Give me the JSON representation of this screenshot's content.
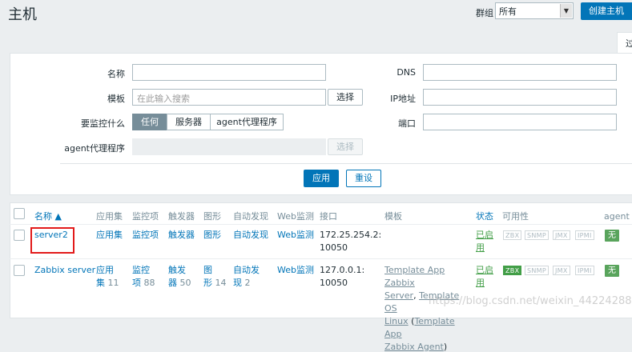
{
  "header": {
    "title": "主机",
    "group_label": "群组",
    "group_value": "所有",
    "create_button": "创建主机",
    "filter_tab": "过"
  },
  "filter": {
    "name_label": "名称",
    "name_value": "",
    "template_label": "模板",
    "template_placeholder": "在此输入搜索",
    "template_select": "选择",
    "monitor_label": "要监控什么",
    "monitor_options": [
      "任何",
      "服务器",
      "agent代理程序"
    ],
    "monitor_selected": "任何",
    "proxy_label": "agent代理程序",
    "proxy_select": "选择",
    "dns_label": "DNS",
    "ip_label": "IP地址",
    "port_label": "端口",
    "apply_button": "应用",
    "reset_button": "重设"
  },
  "table": {
    "headers": {
      "name": "名称 ▲",
      "applications": "应用集",
      "items": "监控项",
      "triggers": "触发器",
      "graphs": "图形",
      "discovery": "自动发现",
      "web": "Web监测",
      "interface": "接口",
      "templates": "模板",
      "status": "状态",
      "availability": "可用性",
      "agent": "agent 加"
    },
    "rows": [
      {
        "name": "server2",
        "applications": "应用集",
        "items": "监控项",
        "triggers": "触发器",
        "graphs": "图形",
        "discovery": "自动发现",
        "web": "Web监测",
        "interface_line1": "172.25.254.2:",
        "interface_line2": "10050",
        "templates": "",
        "status_line1": "已启",
        "status_line2": "用",
        "availability": [
          "ZBX",
          "SNMP",
          "JMX",
          "IPMI"
        ],
        "zbx_active": false,
        "agent_encryption": "无"
      },
      {
        "name": "Zabbix server",
        "applications_l1": "应用",
        "applications_l2": "集",
        "applications_count": "11",
        "items_l1": "监控",
        "items_l2": "项",
        "items_count": "88",
        "triggers_l1": "触发",
        "triggers_l2": "器",
        "triggers_count": "50",
        "graphs_l1": "图",
        "graphs_l2": "形",
        "graphs_count": "14",
        "discovery_l1": "自动发",
        "discovery_l2": "现",
        "discovery_count": "2",
        "web": "Web监测",
        "interface_line1": "127.0.0.1:",
        "interface_line2": "10050",
        "template_1a": "Template App Zabbix",
        "template_1b": "Server",
        "template_sep": ",",
        "template_2a": "Template OS",
        "template_2b": "Linux",
        "template_paren_open": "(",
        "template_3a": "Template App",
        "template_3b": "Zabbix Agent",
        "template_paren_close": ")",
        "status_line1": "已启",
        "status_line2": "用",
        "availability": [
          "ZBX",
          "SNMP",
          "JMX",
          "IPMI"
        ],
        "zbx_active": true,
        "agent_encryption": "无"
      }
    ]
  },
  "watermark": "https://blog.csdn.net/weixin_44224288",
  "colors": {
    "accent": "#0275b8",
    "status_green": "#429e47",
    "highlight_red": "#e21a1a"
  }
}
